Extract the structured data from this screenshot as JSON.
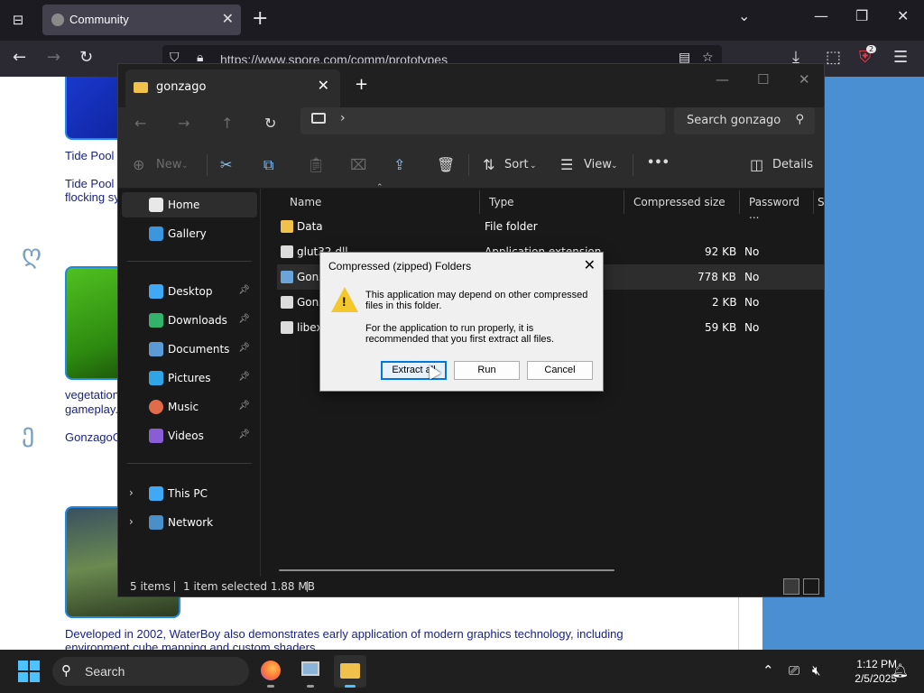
{
  "browser": {
    "tab_title": "Community",
    "url": "https://www.spore.com/comm/prototypes",
    "extensions_badge": "2"
  },
  "webpage": {
    "text1": "Tide Pool",
    "text2a": "Tide Pool",
    "text2b": "flocking sy",
    "text3a": "vegetation",
    "text3b": "gameplay.",
    "text4": "GonzagoG",
    "text5a": "Developed in 2002, WaterBoy also demonstrates early application of modern graphics technology, including",
    "text5b": "environment cube mapping and custom shaders"
  },
  "explorer": {
    "tab_title": "gonzago",
    "search_placeholder": "Search gonzago",
    "commands": {
      "new": "New",
      "sort": "Sort",
      "view": "View",
      "more": "•••",
      "details": "Details"
    },
    "nav": {
      "home": "Home",
      "gallery": "Gallery",
      "desktop": "Desktop",
      "downloads": "Downloads",
      "documents": "Documents",
      "pictures": "Pictures",
      "music": "Music",
      "videos": "Videos",
      "this_pc": "This PC",
      "network": "Network"
    },
    "columns": {
      "name": "Name",
      "type": "Type",
      "compressed": "Compressed size",
      "password": "Password ...",
      "size": "Si"
    },
    "files": [
      {
        "name": "Data",
        "type": "File folder",
        "compressed": "",
        "password": ""
      },
      {
        "name": "glut32.dll",
        "type": "Application extension",
        "compressed": "92 KB",
        "password": "No"
      },
      {
        "name": "Gonz",
        "type": "",
        "compressed": "778 KB",
        "password": "No"
      },
      {
        "name": "Gonz",
        "type": "",
        "compressed": "2 KB",
        "password": "No"
      },
      {
        "name": "libexp",
        "type": "",
        "compressed": "59 KB",
        "password": "No"
      }
    ],
    "status": {
      "items": "5 items",
      "selected": "1 item selected  1.88 MB"
    }
  },
  "dialog": {
    "title": "Compressed (zipped) Folders",
    "msg1": "This application may depend on other compressed files in this folder.",
    "msg2": "For the application to run properly, it is recommended that you first extract all files.",
    "btn_extract": "Extract all",
    "btn_run": "Run",
    "btn_cancel": "Cancel"
  },
  "taskbar": {
    "search_placeholder": "Search",
    "time": "1:12 PM",
    "date": "2/5/2025"
  },
  "colors": {
    "accent": "#4cc2ff",
    "folder": "#f0c24b",
    "warning": "#f4c82c"
  }
}
